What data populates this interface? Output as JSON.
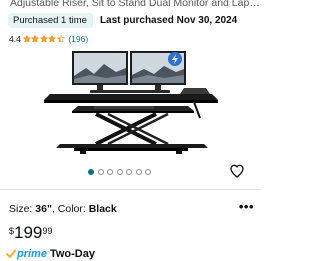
{
  "product": {
    "title": "Adjustable Riser, Sit to Stand Dual Monitor and Laptop…"
  },
  "purchase": {
    "badge": "Purchased 1 time",
    "last_purchased": "Last purchased Nov 30, 2024"
  },
  "rating": {
    "value": "4.4",
    "stars": 4.4,
    "count": "(196)"
  },
  "gallery": {
    "image_count": 7,
    "active_index": 0
  },
  "variant": {
    "size_label": "Size: ",
    "size_value": "36\"",
    "color_label": ", Color: ",
    "color_value": "Black",
    "more": "•••"
  },
  "price": {
    "symbol": "$",
    "whole": "199",
    "fraction": "99"
  },
  "delivery": {
    "prime": "prime",
    "text": "Two-Day"
  },
  "colors": {
    "accent": "#007185",
    "star": "#ffa41c",
    "prime": "#1399ff",
    "badge_bg": "#e7f4f5"
  },
  "icons": {
    "wishlist": "heart-icon",
    "prime_check": "prime-check-icon"
  }
}
